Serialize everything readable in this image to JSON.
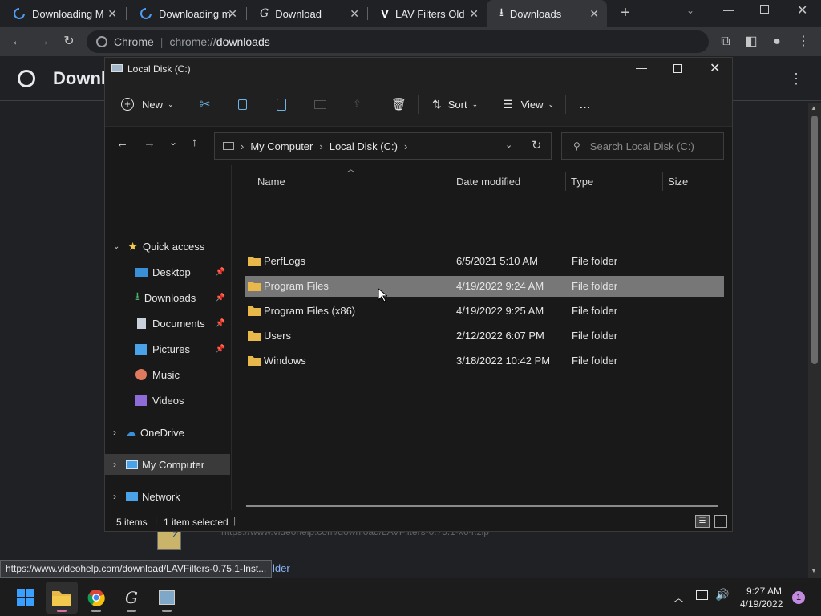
{
  "browser": {
    "tabs": [
      {
        "title": "Downloading M",
        "icon": "edge-loading-icon"
      },
      {
        "title": "Downloading m",
        "icon": "edge-loading-icon"
      },
      {
        "title": "Download",
        "icon": "lav-g-icon"
      },
      {
        "title": "LAV Filters Old I",
        "icon": "videohelp-v-icon"
      },
      {
        "title": "Downloads",
        "icon": "download-icon"
      }
    ],
    "omnibox": {
      "scheme_label": "Chrome",
      "url_prefix": "chrome://",
      "url_path": "downloads"
    },
    "page_title": "Downl",
    "download_url": "https://www.videohelp.com/download/LAVFilters-0.75.1-x64.zip",
    "show_in_folder_fragment": "lder",
    "status_bubble": "https://www.videohelp.com/download/LAVFilters-0.75.1-Inst..."
  },
  "explorer": {
    "title": "Local Disk (C:)",
    "commands": {
      "new": "New",
      "sort": "Sort",
      "view": "View",
      "more": "..."
    },
    "breadcrumb": [
      "My Computer",
      "Local Disk (C:)"
    ],
    "search_placeholder": "Search Local Disk (C:)",
    "nav": {
      "quick_access": "Quick access",
      "items": [
        {
          "label": "Desktop",
          "pinned": true,
          "icon": "desktop-icon"
        },
        {
          "label": "Downloads",
          "pinned": true,
          "icon": "downloads-icon"
        },
        {
          "label": "Documents",
          "pinned": true,
          "icon": "documents-icon"
        },
        {
          "label": "Pictures",
          "pinned": true,
          "icon": "pictures-icon"
        },
        {
          "label": "Music",
          "pinned": false,
          "icon": "music-icon"
        },
        {
          "label": "Videos",
          "pinned": false,
          "icon": "videos-icon"
        }
      ],
      "onedrive": "OneDrive",
      "my_computer": "My Computer",
      "network": "Network"
    },
    "columns": {
      "name": "Name",
      "date": "Date modified",
      "type": "Type",
      "size": "Size"
    },
    "files": [
      {
        "name": "PerfLogs",
        "date": "6/5/2021 5:10 AM",
        "type": "File folder",
        "selected": false
      },
      {
        "name": "Program Files",
        "date": "4/19/2022 9:24 AM",
        "type": "File folder",
        "selected": true
      },
      {
        "name": "Program Files (x86)",
        "date": "4/19/2022 9:25 AM",
        "type": "File folder",
        "selected": false
      },
      {
        "name": "Users",
        "date": "2/12/2022 6:07 PM",
        "type": "File folder",
        "selected": false
      },
      {
        "name": "Windows",
        "date": "3/18/2022 10:42 PM",
        "type": "File folder",
        "selected": false
      }
    ],
    "status": {
      "items": "5 items",
      "selected": "1 item selected"
    }
  },
  "taskbar": {
    "time": "9:27 AM",
    "date": "4/19/2022",
    "notification_count": "1"
  },
  "colors": {
    "folder": "#e8b84a",
    "accent": "#0078d4",
    "selected_row": "#777777"
  }
}
